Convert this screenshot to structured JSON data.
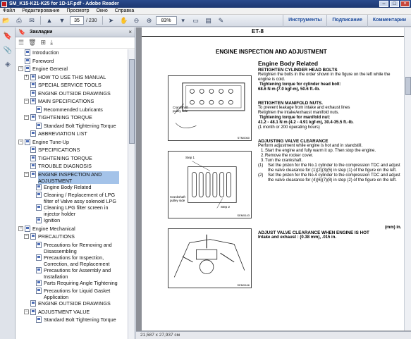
{
  "window": {
    "title": "SM_K15-K21-K25 for 1D-1F.pdf - Adobe Reader"
  },
  "menu": [
    "Файл",
    "Редактирование",
    "Просмотр",
    "Окно",
    "Справка"
  ],
  "toolbar": {
    "current_page": "35",
    "total_pages": "/ 230",
    "zoom": "83%"
  },
  "right_tabs": [
    "Инструменты",
    "Подписание",
    "Комментарии"
  ],
  "panel": {
    "title": "Закладки"
  },
  "bookmarks": [
    {
      "label": "Introduction",
      "toggle": "",
      "level": 0
    },
    {
      "label": "Foreword",
      "toggle": "",
      "level": 0
    },
    {
      "label": "Engine General",
      "toggle": "−",
      "level": 0
    },
    {
      "label": "HOW TO USE THIS MANUAL",
      "toggle": "+",
      "level": 1
    },
    {
      "label": "SPECIAL SERVICE TOOLS",
      "toggle": "",
      "level": 1
    },
    {
      "label": "ENGINE OUTSIDE DRAWINGS",
      "toggle": "",
      "level": 1
    },
    {
      "label": "MAIN SPECIFICATIONS",
      "toggle": "−",
      "level": 1
    },
    {
      "label": "Recommended Lubricants",
      "toggle": "",
      "level": 2
    },
    {
      "label": "TIGHTENING TORQUE",
      "toggle": "−",
      "level": 1
    },
    {
      "label": "Standard Bolt Tightening Torque",
      "toggle": "",
      "level": 2
    },
    {
      "label": "ABBREVIATION LIST",
      "toggle": "",
      "level": 1
    },
    {
      "label": "Engine Tune-Up",
      "toggle": "−",
      "level": 0
    },
    {
      "label": "SPECIFICATIONS",
      "toggle": "",
      "level": 1
    },
    {
      "label": "TIGHTENING TORQUE",
      "toggle": "",
      "level": 1
    },
    {
      "label": "TROUBLE DIAGNOSIS",
      "toggle": "",
      "level": 1
    },
    {
      "label": "ENGINE INSPECTION AND ADJUSTMENT",
      "toggle": "−",
      "level": 1,
      "selected": true,
      "multi": true
    },
    {
      "label": "Engine Body Related",
      "toggle": "",
      "level": 2
    },
    {
      "label": "Cleaning / Replacement of LPG filter of Valve assy solenoid LPG",
      "toggle": "",
      "level": 2,
      "multi": true
    },
    {
      "label": "Cleaning LPG filter screen in injector holder",
      "toggle": "",
      "level": 2,
      "multi": true
    },
    {
      "label": "Ignition",
      "toggle": "",
      "level": 2
    },
    {
      "label": "Engine Mechanical",
      "toggle": "−",
      "level": 0
    },
    {
      "label": "PRECAUTIONS",
      "toggle": "−",
      "level": 1
    },
    {
      "label": "Precautions for Removing and Disassembling",
      "toggle": "",
      "level": 2,
      "multi": true
    },
    {
      "label": "Precautions for Inspection, Correction, and Replacement",
      "toggle": "",
      "level": 2,
      "multi": true
    },
    {
      "label": "Precautions for Assembly and Installation",
      "toggle": "",
      "level": 2,
      "multi": true
    },
    {
      "label": "Parts Requiring Angle Tightening",
      "toggle": "",
      "level": 2
    },
    {
      "label": "Precautions for Liquid Gasket Application",
      "toggle": "",
      "level": 2,
      "multi": true
    },
    {
      "label": "ENGINE OUTSIDE DRAWINGS",
      "toggle": "",
      "level": 1
    },
    {
      "label": "ADJUSTMENT VALUE",
      "toggle": "−",
      "level": 1
    },
    {
      "label": "Standard Bolt Tightening Torque",
      "toggle": "",
      "level": 2
    }
  ],
  "document": {
    "header_code": "ET-8",
    "title": "ENGINE INSPECTION AND ADJUSTMENT",
    "section": "Engine Body Related",
    "fig1": {
      "label": "Crankshaft pulley side",
      "code": "STM0060"
    },
    "fig2": {
      "step1": "Step 1",
      "step2": "Step 2",
      "label": "Crankshaft pulley side",
      "code": "SEM5143"
    },
    "fig3": {
      "code": "SEM5166"
    },
    "head_bolts": {
      "heading": "RETIGHTEN CYLINDER HEAD BOLTS",
      "body": "Retighten the bolts in the order shown in the figure on the left while the engine is cold.",
      "torque_label": "Tightening torque for cylinder head bolt:",
      "torque_value": "68.6 N m (7.0 kgf-m), 50.6 ft.-lb."
    },
    "manifold": {
      "heading": "RETIGHTEN MANIFOLD NUTS.",
      "body1": "To prevent leakage from intake and exhaust lines",
      "body2": "Retighten the intake/exhaust manifold nuts.",
      "torque_label": "Tightening torque for manifold nut:",
      "torque_value": "41.2 - 48.1 N m (4.2 - 4.91 kgf-m), 30.4-35.5 ft.-lb.",
      "note": "(1 month or 200 operating hours)"
    },
    "valve": {
      "heading": "ADJUSTING VALVE CLEARANCE",
      "intro": "Perform adjustment while engine is hot and in standstill.",
      "steps": [
        {
          "n": "1.",
          "t": "Start the engine and fully warm it up. Then stop the engine."
        },
        {
          "n": "2.",
          "t": "Remove the rocker cover."
        },
        {
          "n": "3.",
          "t": "Turn the crankshaft."
        },
        {
          "n": "(1)",
          "t": "Set the piston for the No.1 cylinder to the compression TDC and adjust the valve clearance for (1)(2)(3)(5) in step (1) of the figure on the left."
        },
        {
          "n": "(2)",
          "t": "Set the piston for the No.4 cylinder to the compression TDC and adjust the valve clearance for (4)(6)(7)(8) in step (2) of the figure on the left."
        }
      ]
    },
    "unit": "(mm) in.",
    "hot": {
      "heading": "ADJUST VALVE CLEARANCE WHEN ENGINE IS HOT",
      "value": "Intake and exhaust : (0.38 mm), .015 in."
    }
  },
  "status": {
    "page_size": "21,587 x 27,937 см"
  }
}
